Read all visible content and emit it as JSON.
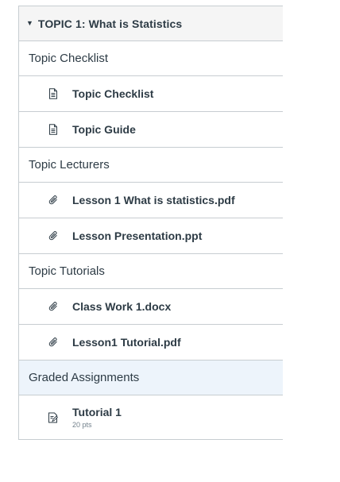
{
  "module": {
    "title": "TOPIC 1: What is Statistics",
    "expanded_icon": "caret-down-icon"
  },
  "rows": [
    {
      "kind": "header",
      "label": "Topic Checklist"
    },
    {
      "kind": "page",
      "icon": "document-icon",
      "label": "Topic Checklist"
    },
    {
      "kind": "page",
      "icon": "document-icon",
      "label": "Topic Guide"
    },
    {
      "kind": "header",
      "label": "Topic Lecturers"
    },
    {
      "kind": "file",
      "icon": "paperclip-icon",
      "label": "Lesson 1 What is statistics.pdf"
    },
    {
      "kind": "file",
      "icon": "paperclip-icon",
      "label": "Lesson Presentation.ppt"
    },
    {
      "kind": "header",
      "label": "Topic Tutorials"
    },
    {
      "kind": "file",
      "icon": "paperclip-icon",
      "label": "Class Work 1.docx"
    },
    {
      "kind": "file",
      "icon": "paperclip-icon",
      "label": "Lesson1 Tutorial.pdf"
    },
    {
      "kind": "header",
      "label": "Graded Assignments",
      "highlight": true
    },
    {
      "kind": "assignment",
      "icon": "assignment-icon",
      "label": "Tutorial 1",
      "points": "20 pts"
    }
  ],
  "colors": {
    "text": "#2d3b45",
    "border": "#c7cdd1",
    "header_bg": "#f5f5f5",
    "highlight_bg": "#edf4fb",
    "muted": "#73818c"
  }
}
